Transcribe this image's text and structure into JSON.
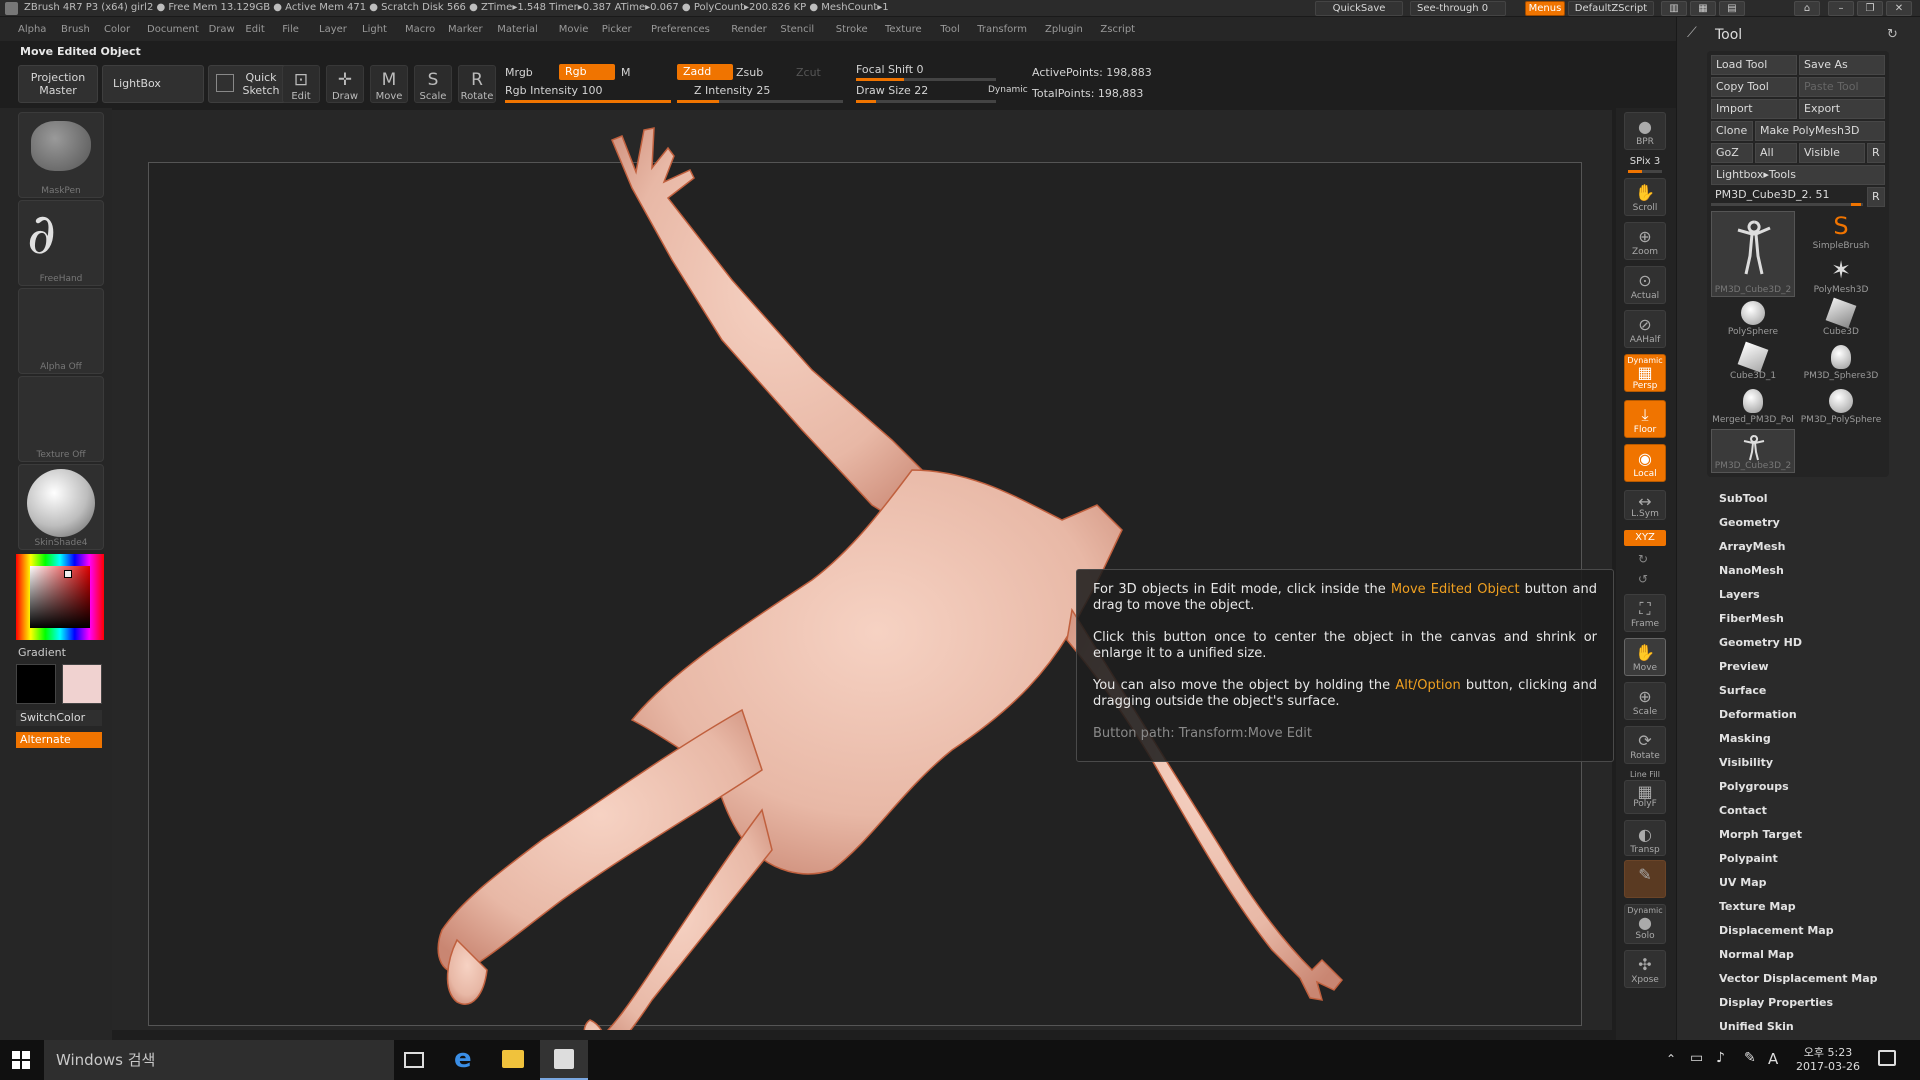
{
  "status": {
    "text": "ZBrush 4R7 P3 (x64)   girl2    ● Free Mem 13.129GB ● Active Mem 471 ● Scratch Disk 566 ●  ZTime▸1.548 Timer▸0.387 ATime▸0.067 ● PolyCount▸200.826 KP  ● MeshCount▸1",
    "quicksave": "QuickSave",
    "seethrough": "See-through   0",
    "menus": "Menus",
    "script": "DefaultZScript"
  },
  "menubar": {
    "items": [
      "Alpha",
      "Brush",
      "Color",
      "Document",
      "Draw",
      "Edit",
      "File",
      "Layer",
      "Light",
      "Macro",
      "Marker",
      "Material",
      "Movie",
      "Picker",
      "Preferences",
      "Render",
      "Stencil",
      "Stroke",
      "Texture",
      "Tool",
      "Transform",
      "Zplugin",
      "Zscript"
    ]
  },
  "current_action": "Move Edited Object",
  "shelf": {
    "projection_master": "Projection\nMaster",
    "lightbox": "LightBox",
    "quick_sketch": "Quick\nSketch",
    "edit": "Edit",
    "draw": "Draw",
    "move": "Move",
    "scale": "Scale",
    "rotate": "Rotate",
    "mrgb": "Mrgb",
    "rgb": "Rgb",
    "m": "M",
    "rgb_intensity": "Rgb Intensity 100",
    "zadd": "Zadd",
    "zsub": "Zsub",
    "zcut": "Zcut",
    "z_intensity": "Z Intensity 25",
    "focal_shift": "Focal Shift 0",
    "draw_size": "Draw Size 22",
    "dynamic": "Dynamic",
    "active_points": "ActivePoints: 198,883",
    "total_points": "TotalPoints: 198,883",
    "rgb_intensity_value": 100,
    "z_intensity_value": 25
  },
  "lefttray": {
    "brush": "MaskPen",
    "stroke": "FreeHand",
    "alpha": "Alpha  Off",
    "texture": "Texture  Off",
    "material": "SkinShade4",
    "gradient": "Gradient",
    "switchcolor": "SwitchColor",
    "alternate": "Alternate"
  },
  "righttray": {
    "bpr": "BPR",
    "spix": "SPix 3",
    "scroll": "Scroll",
    "zoom": "Zoom",
    "actual": "Actual",
    "aahalf": "AAHalf",
    "dynamic": "Dynamic",
    "persp": "Persp",
    "floor": "Floor",
    "local": "Local",
    "lsym": "L.Sym",
    "xyz": "XYZ",
    "frame": "Frame",
    "move": "Move",
    "scale": "Scale",
    "rotate": "Rotate",
    "linefill": "Line Fill",
    "polyf": "PolyF",
    "transp": "Transp",
    "dynamic2": "Dynamic",
    "solo": "Solo",
    "xpose": "Xpose"
  },
  "tooltip": {
    "line1_a": "For 3D objects in Edit mode, click inside the ",
    "line1_hl": "Move Edited Object",
    "line1_b": " button and drag to move the object.",
    "line2": "Click this button once to center the object in the canvas and shrink or enlarge it to a unified size.",
    "line3_a": "You can also move the object by holding the ",
    "line3_hl": "Alt/Option",
    "line3_b": " button, clicking and dragging outside the object's surface.",
    "path": "Button path: Transform:Move Edit"
  },
  "toolpanel": {
    "title": "Tool",
    "load_tool": "Load Tool",
    "save_as": "Save As",
    "copy_tool": "Copy Tool",
    "paste_tool": "Paste Tool",
    "import": "Import",
    "export": "Export",
    "clone": "Clone",
    "make_polymesh": "Make PolyMesh3D",
    "goz": "GoZ",
    "all": "All",
    "visible": "Visible",
    "r": "R",
    "lightbox_tools": "Lightbox▸Tools",
    "current_tool": "PM3D_Cube3D_2. 51",
    "r2": "R",
    "tools": [
      {
        "label": "PM3D_Cube3D_2"
      },
      {
        "label": "SimpleBrush"
      },
      {
        "label": "PolyMesh3D"
      },
      {
        "label": "PolySphere"
      },
      {
        "label": "Cube3D"
      },
      {
        "label": "Cube3D_1"
      },
      {
        "label": "PM3D_Sphere3D"
      },
      {
        "label": "Merged_PM3D_Pol"
      },
      {
        "label": "PM3D_PolySphere"
      },
      {
        "label": "PM3D_Cube3D_2"
      }
    ],
    "subpalettes": [
      "SubTool",
      "Geometry",
      "ArrayMesh",
      "NanoMesh",
      "Layers",
      "FiberMesh",
      "Geometry HD",
      "Preview",
      "Surface",
      "Deformation",
      "Masking",
      "Visibility",
      "Polygroups",
      "Contact",
      "Morph Target",
      "Polypaint",
      "UV Map",
      "Texture Map",
      "Displacement Map",
      "Normal Map",
      "Vector Displacement Map",
      "Display Properties",
      "Unified Skin"
    ]
  },
  "taskbar": {
    "search": "Windows 검색",
    "time": "오후 5:23",
    "date": "2017-03-26",
    "ime": "A"
  },
  "colors": {
    "accent": "#f07400",
    "skin": "#e8b8a6",
    "secondary_color": "#f0d2d0"
  }
}
